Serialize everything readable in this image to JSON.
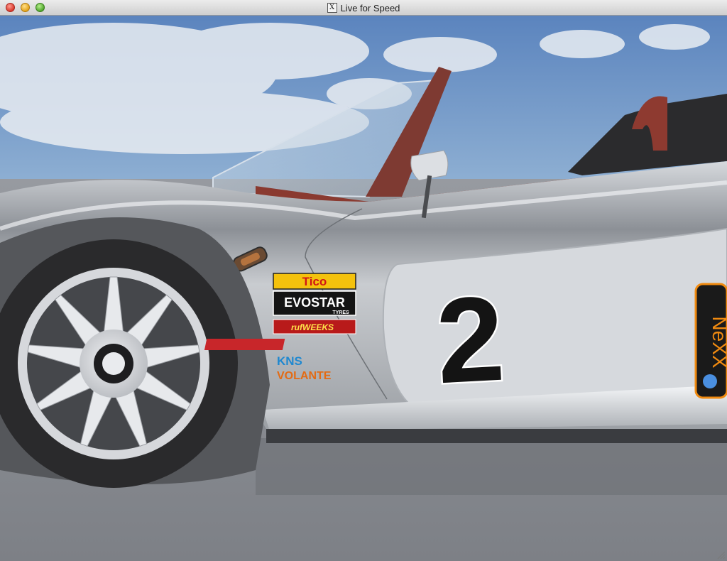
{
  "window": {
    "title": "Live for Speed",
    "app_icon": "x11-icon"
  },
  "car": {
    "race_number": "2",
    "sponsors": [
      "Tico",
      "EVOSTAR",
      "TYRES",
      "rufWEEKS",
      "KNS",
      "VOLANTE",
      "NeXX"
    ]
  },
  "colors": {
    "sky": "#6e95c6",
    "ground": "#8d8f94",
    "body_silver": "#b6b9bd",
    "tyre": "#2a2a2c",
    "seat_red": "#8e3a30"
  }
}
